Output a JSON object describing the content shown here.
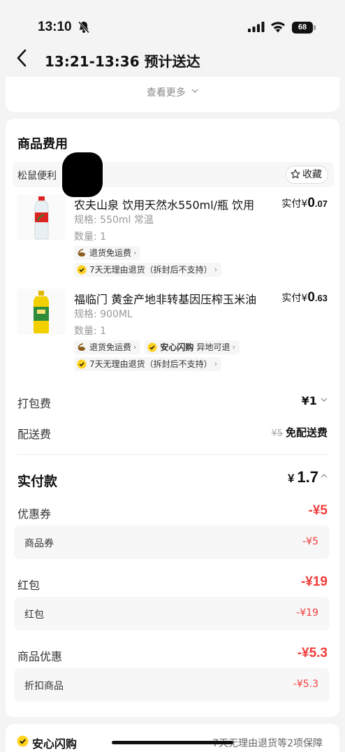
{
  "status_bar": {
    "time": "13:10",
    "battery": "68"
  },
  "header": {
    "title": "13:21-13:36 预计送达"
  },
  "top_card": {
    "see_more": "查看更多"
  },
  "fee_section": {
    "title": "商品费用",
    "shop_name": "松鼠便利",
    "favorite_label": "收藏"
  },
  "products": [
    {
      "name": "农夫山泉 饮用天然水550ml/瓶 饮用",
      "price_prefix": "实付",
      "price_currency": "¥",
      "price_int": "0",
      "price_dec": ".07",
      "spec": "规格: 550ml 常温",
      "qty": "数量: 1",
      "tag_return_shipping": "退货免运费",
      "tag_seven_day": "7天无理由退货（拆封后不支持）"
    },
    {
      "name": "福临门 黄金产地非转基因压榨玉米油",
      "price_prefix": "实付",
      "price_currency": "¥",
      "price_int": "0",
      "price_dec": ".63",
      "spec": "规格: 900ML",
      "qty": "数量: 1",
      "tag_return_shipping": "退货免运费",
      "tag_flash_brand": "安心闪购",
      "tag_flash_text": "异地可退",
      "tag_seven_day": "7天无理由退货（拆封后不支持）"
    }
  ],
  "fees": {
    "packing_label": "打包费",
    "packing_value": "¥1",
    "delivery_label": "配送费",
    "delivery_original": "¥5",
    "delivery_value": "免配送费"
  },
  "total": {
    "label": "实付款",
    "currency": "¥",
    "value": "1.7"
  },
  "discounts": [
    {
      "label": "优惠券",
      "value": "-¥5",
      "sub_label": "商品券",
      "sub_value": "-¥5"
    },
    {
      "label": "红包",
      "value": "-¥19",
      "sub_label": "红包",
      "sub_value": "-¥19"
    },
    {
      "label": "商品优惠",
      "value": "-¥5.3",
      "sub_label": "折扣商品",
      "sub_value": "-¥5.3"
    }
  ],
  "bottom_bar": {
    "brand": "安心闪购",
    "promo": "7天无理由退货等2项保障"
  },
  "colors": {
    "discount_red": "#f23d3d",
    "badge_yellow": "#ffd21f",
    "background": "#f4f4f4"
  },
  "icons": [
    "bell-slash-icon",
    "signal-icon",
    "wifi-icon",
    "battery-icon",
    "back-arrow-icon",
    "chevron-down-icon",
    "star-icon",
    "shield-check-icon",
    "return-truck-icon",
    "chevron-up-icon"
  ]
}
